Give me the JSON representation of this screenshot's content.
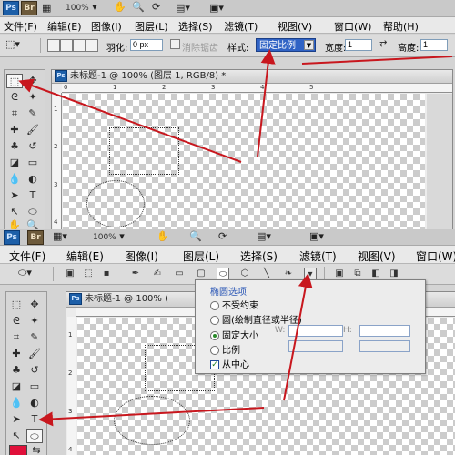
{
  "top": {
    "app_badge": "Ps",
    "bridge_badge": "Br",
    "zoom": "100%",
    "menu": [
      "文件(F)",
      "编辑(E)",
      "图像(I)",
      "图层(L)",
      "选择(S)",
      "滤镜(T)",
      "视图(V)",
      "窗口(W)",
      "帮助(H)"
    ],
    "options": {
      "feather_label": "羽化:",
      "feather_value": "0 px",
      "antialias_label": "消除锯齿",
      "style_label": "样式:",
      "style_value": "固定比例",
      "width_label": "宽度:",
      "width_value": "1",
      "height_label": "高度:",
      "height_value": "1"
    },
    "document_title": "未标题-1 @ 100% (图层 1, RGB/8) *",
    "ruler_h": [
      "0",
      "1",
      "2",
      "3",
      "4",
      "5"
    ],
    "ruler_v": [
      "1",
      "2",
      "3",
      "4"
    ]
  },
  "bottom": {
    "app_badge": "Ps",
    "bridge_badge": "Br",
    "zoom": "100%",
    "menu": [
      "文件(F)",
      "编辑(E)",
      "图像(I)",
      "图层(L)",
      "选择(S)",
      "滤镜(T)",
      "视图(V)",
      "窗口(W)"
    ],
    "document_title": "未标题-1 @ 100% (",
    "popup": {
      "title": "椭圆选项",
      "options": [
        "不受约束",
        "圆(绘制直径或半径)",
        "固定大小",
        "比例"
      ],
      "selected_index": 2,
      "from_center_label": "从中心",
      "from_center_checked": true,
      "w_label": "W:",
      "h_label": "H:"
    },
    "ruler_v": [
      "1",
      "2",
      "3",
      "4"
    ]
  },
  "colors": {
    "annotation_arrow": "#c8171e",
    "selected_dropdown": "#3063c5",
    "foreground_swatch": "#e0103a"
  }
}
